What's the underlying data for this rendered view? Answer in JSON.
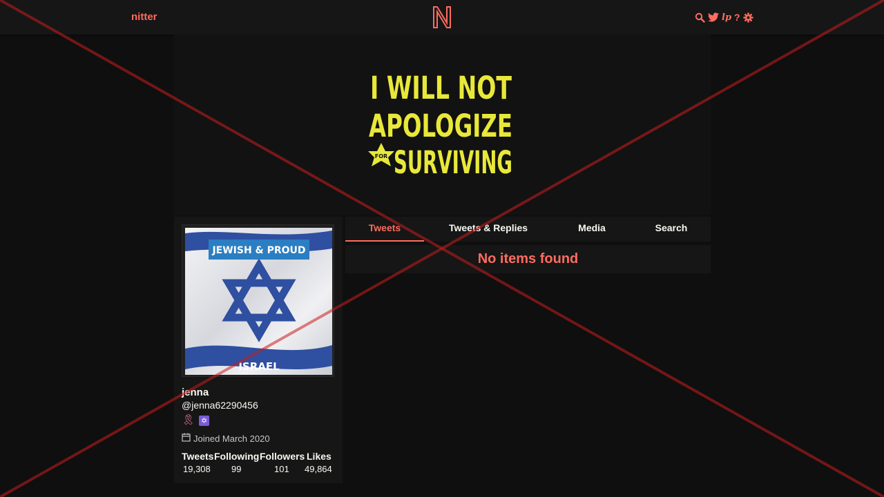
{
  "navbar": {
    "brand": "nitter",
    "logo_letter": "N",
    "icons": [
      "search-icon",
      "twitter-bird-icon",
      "lp-icon",
      "help-icon",
      "gear-icon"
    ],
    "lp_label": "lp",
    "help_label": "?"
  },
  "banner": {
    "lines": [
      "I WILL NOT",
      "APOLOGIZE",
      "SURVIVING"
    ],
    "badge_text": "FOR"
  },
  "profile": {
    "avatar_badge": "JEWISH & PROUD",
    "avatar_caption": "ISRAEL",
    "fullname": "jenna",
    "username": "@jenna62290456",
    "joined": "Joined March 2020",
    "stats": [
      {
        "label": "Tweets",
        "value": "19,308"
      },
      {
        "label": "Following",
        "value": "99"
      },
      {
        "label": "Followers",
        "value": "101"
      },
      {
        "label": "Likes",
        "value": "49,864"
      }
    ]
  },
  "tabs": [
    {
      "label": "Tweets",
      "active": true
    },
    {
      "label": "Tweets & Replies",
      "active": false
    },
    {
      "label": "Media",
      "active": false
    },
    {
      "label": "Search",
      "active": false
    }
  ],
  "timeline": {
    "empty_message": "No items found"
  },
  "colors": {
    "accent": "#ff6c60",
    "background": "#0f0f0f",
    "panel": "#161616",
    "banner_text": "#e8e83a",
    "flag_blue": "#2f4fa0"
  }
}
